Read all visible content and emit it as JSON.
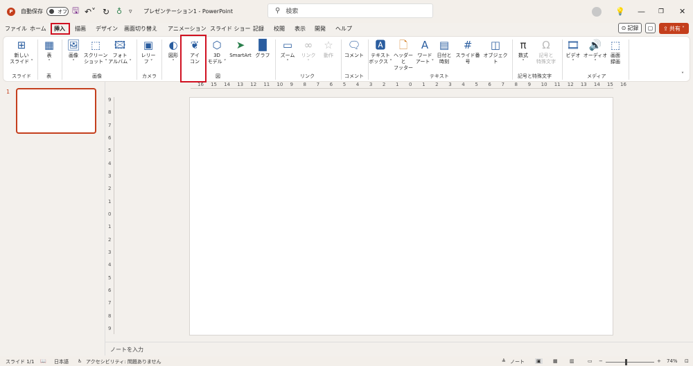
{
  "titlebar": {
    "logo": "P",
    "autosave_label": "自動保存",
    "autosave_state": "オフ",
    "doc_title": "プレゼンテーション1 - PowerPoint",
    "search_placeholder": "検索",
    "icons": [
      "save-icon",
      "undo-icon",
      "redo-icon",
      "present-icon",
      "customize-icon",
      "avatar",
      "lightbulb-icon",
      "minimize-icon",
      "maximize-icon",
      "close-icon"
    ]
  },
  "menu": {
    "tabs": [
      "ファイル",
      "ホーム",
      "挿入",
      "描画",
      "デザイン",
      "画面切り替え",
      "アニメーション",
      "スライド ショー",
      "記録",
      "校閲",
      "表示",
      "開発",
      "ヘルプ"
    ],
    "active_tab": "挿入",
    "record_label": "記録",
    "share_label": "共有"
  },
  "ribbon": {
    "buttons": {
      "new_slide": "新しい\nスライド ˅",
      "table": "表\n˅",
      "image": "画像\n˅",
      "screenshot": "スクリーン\nショット ˅",
      "photo_album": "フォト\nアルバム ˅",
      "cameo": "レリー\nフ ˅",
      "shapes": "図形\n˅",
      "icons": "アイ\nコン",
      "models3d": "3D\nモデル ˅",
      "smartart": "SmartArt",
      "chart": "グラフ",
      "zoom": "ズーム\n˅",
      "link": "リンク\n˅",
      "action": "動作",
      "comment": "コメント",
      "textbox": "テキスト\nボックス ˅",
      "header_footer": "ヘッダーと\nフッター",
      "wordart": "ワード\nアート ˅",
      "datetime": "日付と\n時刻",
      "slide_number": "スライド番号",
      "object": "オブジェクト",
      "equation": "数式\n˅",
      "symbol": "記号と\n特殊文字",
      "video": "ビデオ\n˅",
      "audio": "オーディオ\n˅",
      "screen_recording": "画面\n録画"
    },
    "groups": {
      "slides": "スライド",
      "tables": "表",
      "images": "画像",
      "camera": "カメラ",
      "illustrations": "図",
      "links": "リンク",
      "comments": "コメント",
      "text": "テキスト",
      "symbols": "記号と特殊文字",
      "media": "メディア"
    }
  },
  "slides_pane": {
    "slide_number": "1"
  },
  "rulers": {
    "horizontal": [
      "16",
      "15",
      "14",
      "13",
      "12",
      "11",
      "10",
      "9",
      "8",
      "7",
      "6",
      "5",
      "4",
      "3",
      "2",
      "1",
      "0",
      "1",
      "2",
      "3",
      "4",
      "5",
      "6",
      "7",
      "8",
      "9",
      "10",
      "11",
      "12",
      "13",
      "14",
      "15",
      "16"
    ],
    "vertical": [
      "9",
      "8",
      "7",
      "6",
      "5",
      "4",
      "3",
      "2",
      "1",
      "0",
      "1",
      "2",
      "3",
      "4",
      "5",
      "6",
      "7",
      "8",
      "9"
    ]
  },
  "notes_placeholder": "ノートを入力",
  "statusbar": {
    "slide_count": "スライド 1/1",
    "language": "日本語",
    "accessibility": "アクセシビリティ: 問題ありません",
    "notes_label": "ノート",
    "zoom": "74%"
  },
  "colors": {
    "accent": "#c43e1c",
    "highlight_box": "#d01020"
  }
}
